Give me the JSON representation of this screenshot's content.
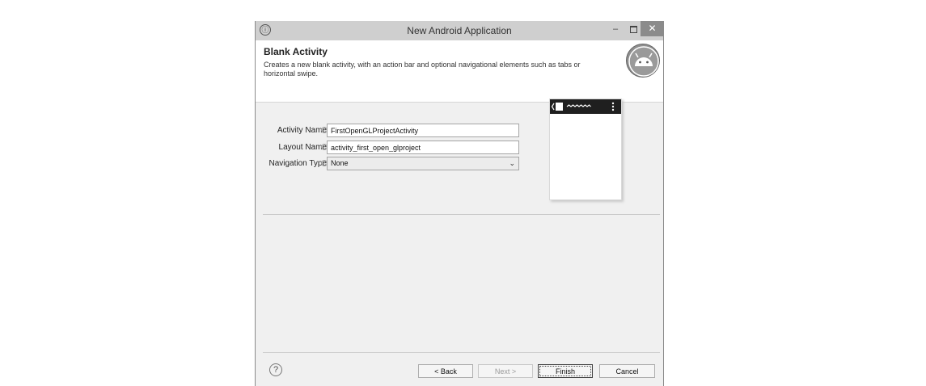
{
  "window": {
    "title": "New Android Application",
    "controls": {
      "minimize": "–",
      "close": "✕"
    }
  },
  "header": {
    "title": "Blank Activity",
    "description": "Creates a new blank activity, with an action bar and optional navigational elements such as tabs or horizontal swipe."
  },
  "form": {
    "activity_name": {
      "label": "Activity Name",
      "value": "FirstOpenGLProjectActivity"
    },
    "layout_name": {
      "label": "Layout Name",
      "value": "activity_first_open_glproject"
    },
    "navigation_type": {
      "label": "Navigation Type",
      "selected": "None"
    }
  },
  "buttons": {
    "back": "< Back",
    "next": "Next >",
    "finish": "Finish",
    "cancel": "Cancel"
  },
  "icons": {
    "app": "info-icon",
    "help": "help-icon",
    "chevron": "chevron-down-icon"
  },
  "colors": {
    "titlebar": "#cfcfcf",
    "close_button": "#8b8b8b",
    "preview_bar": "#1f1f1f"
  }
}
